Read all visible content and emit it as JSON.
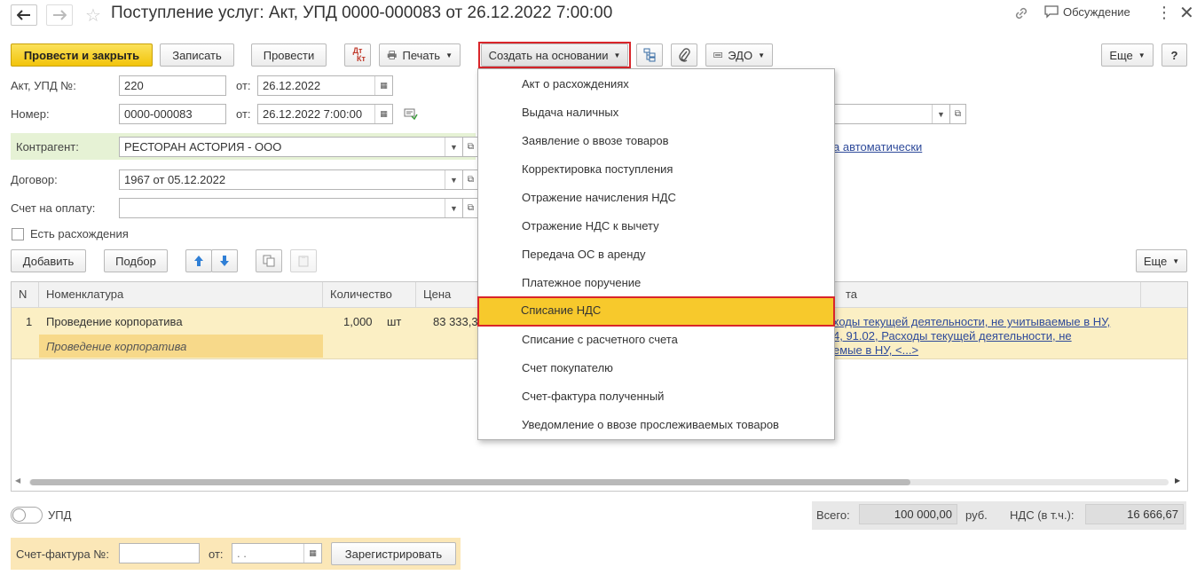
{
  "header": {
    "title": "Поступление услуг: Акт, УПД 0000-000083 от 26.12.2022 7:00:00",
    "discussion": "Обсуждение"
  },
  "toolbar": {
    "post_close": "Провести и закрыть",
    "save": "Записать",
    "post": "Провести",
    "dtkt_top": "Дт",
    "dtkt_bottom": "Кт",
    "print": "Печать",
    "create_based": "Создать на основании",
    "edo": "ЭДО",
    "more": "Еще",
    "help": "?"
  },
  "form": {
    "act_label": "Акт, УПД №:",
    "act_value": "220",
    "from_label": "от:",
    "act_date": "26.12.2022",
    "number_label": "Номер:",
    "number_value": "0000-000083",
    "number_date": "26.12.2022  7:00:00",
    "counterparty_label": "Контрагент:",
    "counterparty_value": "РЕСТОРАН АСТОРИЯ - ООО",
    "contract_label": "Договор:",
    "contract_value": "1967 от 05.12.2022",
    "invoice_label": "Счет на оплату:",
    "invoice_value": "",
    "discrepancies_label": "Есть расхождения",
    "auto_link": "а автоматически"
  },
  "table_toolbar": {
    "add": "Добавить",
    "pick": "Подбор",
    "more": "Еще"
  },
  "table": {
    "columns": [
      "N",
      "Номенклатура",
      "Количество",
      "Цена",
      "та"
    ],
    "rows": [
      {
        "n": "1",
        "name": "Проведение корпоратива",
        "name_sub": "Проведение корпоратива",
        "qty": "1,000",
        "unit": "шт",
        "price": "83 333,3",
        "account_line1": "ходы текущей деятельности, не учитываемые в НУ,",
        "account_line2": "4, 91.02, Расходы текущей деятельности, не",
        "account_line3": "емые в НУ, <...>"
      }
    ]
  },
  "menu": {
    "items": [
      "Акт о расхождениях",
      "Выдача наличных",
      "Заявление о ввозе товаров",
      "Корректировка поступления",
      "Отражение начисления НДС",
      "Отражение НДС к вычету",
      "Передача ОС в аренду",
      "Платежное поручение",
      "Списание НДС",
      "Списание с расчетного счета",
      "Счет покупателю",
      "Счет-фактура полученный",
      "Уведомление о ввозе прослеживаемых товаров"
    ],
    "highlighted_index": 8
  },
  "footer": {
    "upd_label": "УПД",
    "total_label": "Всего:",
    "total_value": "100 000,00",
    "currency": "руб.",
    "vat_label": "НДС (в т.ч.):",
    "vat_value": "16 666,67",
    "sf_label": "Счет-фактура №:",
    "sf_value": "",
    "sf_from": "от:",
    "sf_date": " .  .",
    "register": "Зарегистрировать"
  },
  "colors": {
    "primary_yellow": "#f2c40b",
    "highlight": "#f7c92c",
    "red_frame": "#d9252a",
    "row_yellow": "#fbefc4",
    "green_row": "#e6f2d5",
    "link": "#2e4a9a"
  }
}
